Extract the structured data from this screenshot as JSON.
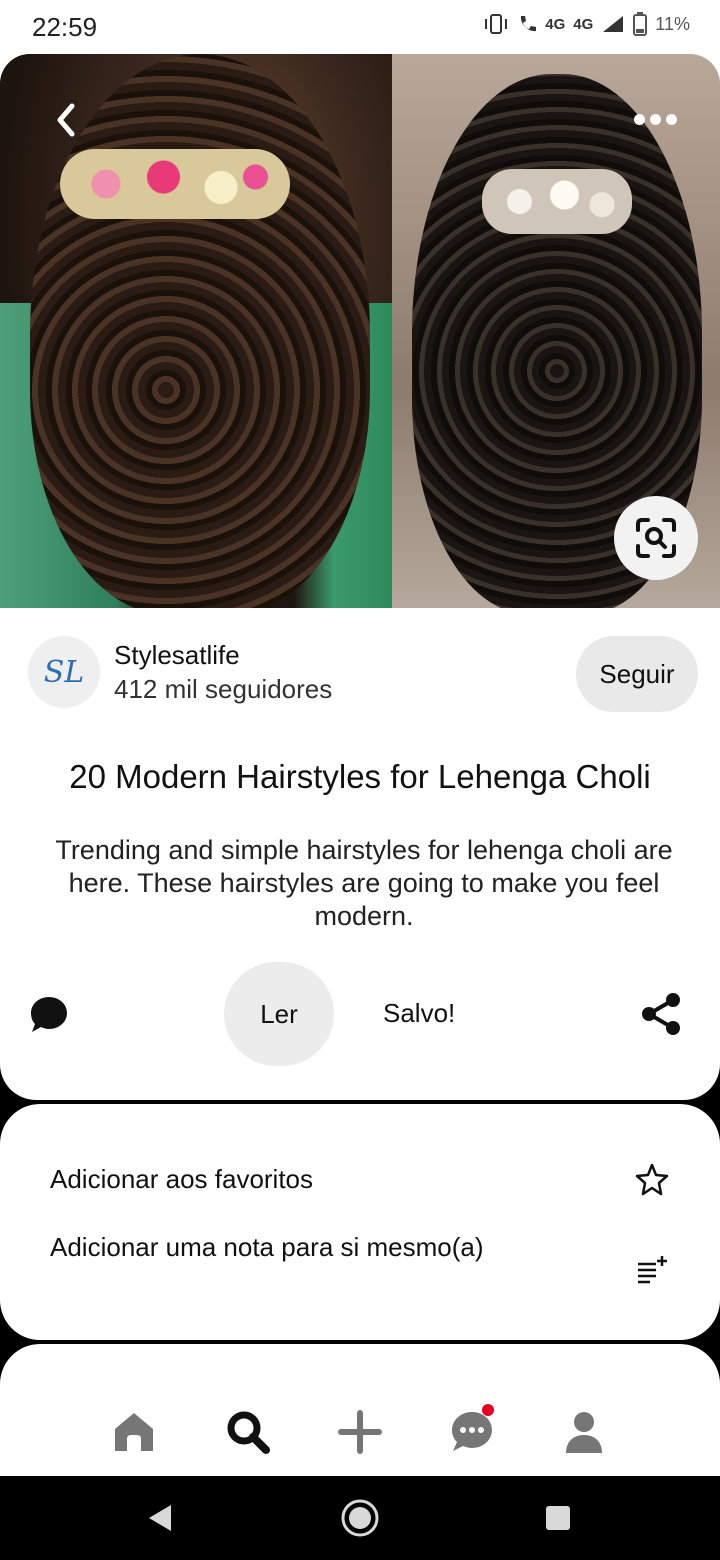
{
  "status_bar": {
    "time": "22:59",
    "network_1": "4G",
    "network_2": "4G",
    "battery": "11%"
  },
  "pin": {
    "images": [
      "hairstyle-photo-left",
      "hairstyle-photo-right"
    ],
    "creator": {
      "avatar_text": "SL",
      "name": "Stylesatlife",
      "followers": "412 mil seguidores",
      "follow_label": "Seguir"
    },
    "title": "20 Modern Hairstyles for Lehenga Choli",
    "description": "Trending and simple hairstyles for lehenga choli are here. These hairstyles are going to make you feel modern.",
    "actions": {
      "read_label": "Ler",
      "saved_label": "Salvo!"
    }
  },
  "options": [
    {
      "label": "Adicionar aos favoritos",
      "icon": "star-outline-icon"
    },
    {
      "label": "Adicionar uma nota para si mesmo(a)",
      "icon": "add-note-icon"
    }
  ],
  "bottom_nav": [
    {
      "name": "home",
      "icon": "home-icon"
    },
    {
      "name": "search",
      "icon": "search-icon"
    },
    {
      "name": "create",
      "icon": "plus-icon"
    },
    {
      "name": "messages",
      "icon": "chat-icon",
      "notification": true
    },
    {
      "name": "profile",
      "icon": "profile-icon"
    }
  ],
  "colors": {
    "accent_red": "#e60023",
    "button_gray": "#e9e9e9",
    "avatar_blue": "#2c6fb3"
  }
}
